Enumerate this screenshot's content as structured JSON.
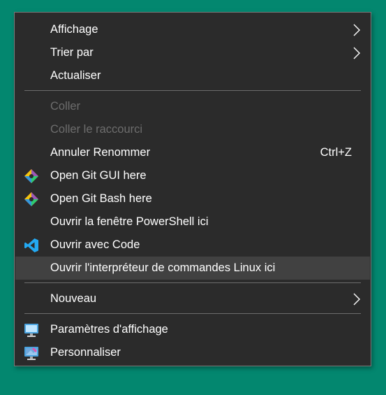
{
  "context_menu": {
    "view": {
      "label": "Affichage",
      "icon": "chevron-right-icon"
    },
    "sort_by": {
      "label": "Trier par",
      "icon": "chevron-right-icon"
    },
    "refresh": {
      "label": "Actualiser"
    },
    "paste": {
      "label": "Coller",
      "enabled": false
    },
    "paste_shortcut": {
      "label": "Coller le raccourci",
      "enabled": false
    },
    "undo_rename": {
      "label": "Annuler Renommer",
      "shortcut": "Ctrl+Z"
    },
    "git_gui": {
      "label": "Open Git GUI here",
      "icon": "git-icon"
    },
    "git_bash": {
      "label": "Open Git Bash here",
      "icon": "git-icon"
    },
    "powershell": {
      "label": "Ouvrir la fenêtre PowerShell ici"
    },
    "vscode": {
      "label": "Ouvrir avec Code",
      "icon": "vscode-icon"
    },
    "linux_shell": {
      "label": "Ouvrir l'interpréteur de commandes Linux ici",
      "highlighted": true
    },
    "new": {
      "label": "Nouveau",
      "icon": "chevron-right-icon"
    },
    "display_settings": {
      "label": "Paramètres d'affichage",
      "icon": "display-settings-icon"
    },
    "personalize": {
      "label": "Personnaliser",
      "icon": "personalize-icon"
    }
  },
  "colors": {
    "desktop": "#03876f",
    "menu_background": "#2b2b2b",
    "menu_text": "#ffffff",
    "disabled_text": "#6d6d6d",
    "highlight": "#414141"
  }
}
